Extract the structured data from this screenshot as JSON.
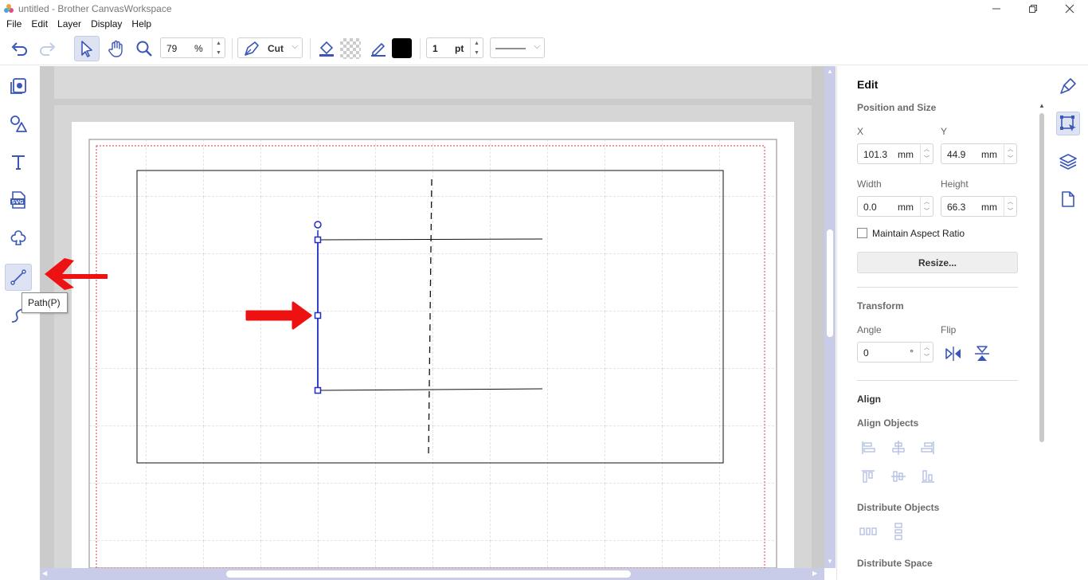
{
  "window": {
    "title": "untitled - Brother CanvasWorkspace"
  },
  "menu": [
    "File",
    "Edit",
    "Layer",
    "Display",
    "Help"
  ],
  "toolbar": {
    "zoom_value": "79",
    "zoom_unit": "%",
    "mode_label": "Cut",
    "line_width_value": "1",
    "line_width_unit": "pt",
    "line_color": "#000000"
  },
  "tooltip": "Path(P)",
  "panel": {
    "title": "Edit",
    "position_size": "Position and Size",
    "x_label": "X",
    "x_value": "101.3",
    "x_unit": "mm",
    "y_label": "Y",
    "y_value": "44.9",
    "y_unit": "mm",
    "width_label": "Width",
    "width_value": "0.0",
    "width_unit": "mm",
    "height_label": "Height",
    "height_value": "66.3",
    "height_unit": "mm",
    "maintain_aspect": "Maintain Aspect Ratio",
    "resize_button": "Resize...",
    "transform": "Transform",
    "angle_label": "Angle",
    "angle_value": "0",
    "angle_unit": "°",
    "flip_label": "Flip",
    "align": "Align",
    "align_objects": "Align Objects",
    "distribute_objects": "Distribute Objects",
    "distribute_space": "Distribute Space"
  },
  "colors": {
    "accent": "#3a56b8",
    "selection": "#1f2ccc",
    "annotation_arrow": "#ee1111",
    "guide": "#e0393a"
  }
}
